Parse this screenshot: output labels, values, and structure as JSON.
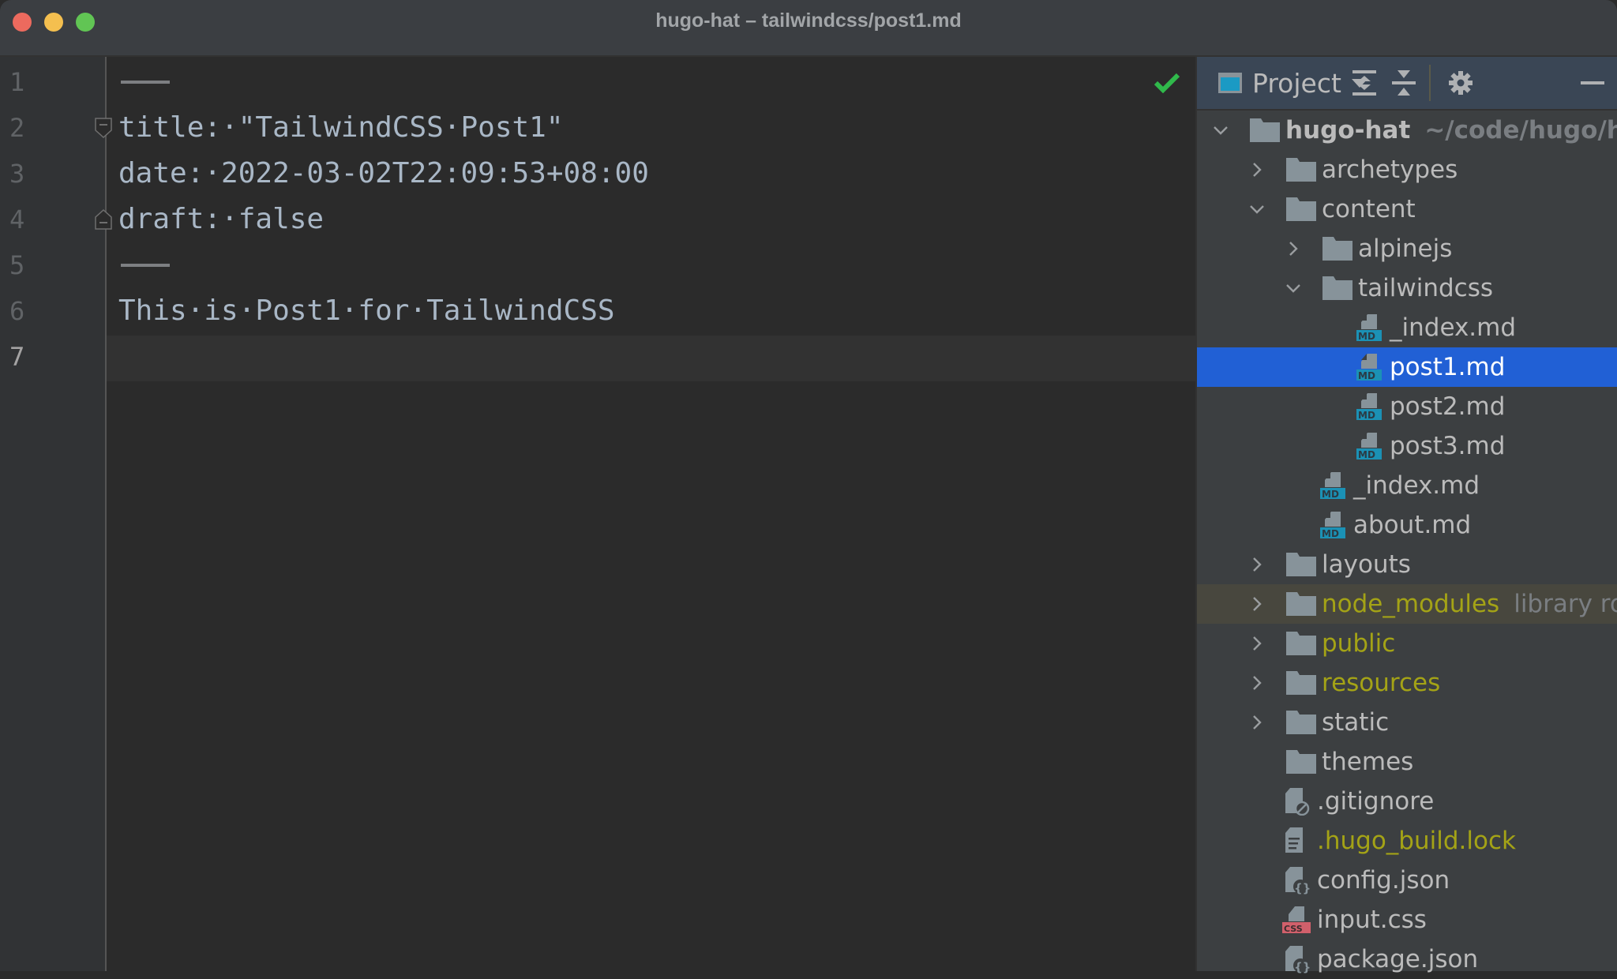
{
  "window": {
    "title": "hugo-hat – tailwindcss/post1.md"
  },
  "editor": {
    "lines": [
      {
        "num": "1",
        "text": "",
        "type": "front-matter-delimiter"
      },
      {
        "num": "2",
        "text": "title:·\"TailwindCSS·Post1\"",
        "type": "code",
        "fold": "start"
      },
      {
        "num": "3",
        "text": "date:·2022-03-02T22:09:53+08:00",
        "type": "code"
      },
      {
        "num": "4",
        "text": "draft:·false",
        "type": "code",
        "fold": "end"
      },
      {
        "num": "5",
        "text": "",
        "type": "front-matter-delimiter"
      },
      {
        "num": "6",
        "text": "This·is·Post1·for·TailwindCSS",
        "type": "code"
      },
      {
        "num": "7",
        "text": "",
        "type": "current"
      }
    ],
    "inspection_status": "no-problems",
    "colors": {
      "text": "#a9b7c6",
      "check": "#30b94b"
    }
  },
  "project_panel": {
    "title": "Project",
    "toolbar": [
      "expand-all-icon",
      "collapse-all-icon",
      "gear-icon",
      "minimize-icon"
    ],
    "tree": [
      {
        "label": "hugo-hat",
        "hint": "~/code/hugo/hu",
        "level": 0,
        "kind": "folder",
        "expanded": true,
        "bold": true
      },
      {
        "label": "archetypes",
        "level": 1,
        "kind": "folder",
        "expanded": false
      },
      {
        "label": "content",
        "level": 1,
        "kind": "folder",
        "expanded": true
      },
      {
        "label": "alpinejs",
        "level": 2,
        "kind": "folder",
        "expanded": false
      },
      {
        "label": "tailwindcss",
        "level": 2,
        "kind": "folder",
        "expanded": true
      },
      {
        "label": "_index.md",
        "level": 3,
        "kind": "md"
      },
      {
        "label": "post1.md",
        "level": 3,
        "kind": "md",
        "selected": true
      },
      {
        "label": "post2.md",
        "level": 3,
        "kind": "md"
      },
      {
        "label": "post3.md",
        "level": 3,
        "kind": "md"
      },
      {
        "label": "_index.md",
        "level": 2,
        "kind": "md"
      },
      {
        "label": "about.md",
        "level": 2,
        "kind": "md"
      },
      {
        "label": "layouts",
        "level": 1,
        "kind": "folder",
        "expanded": false
      },
      {
        "label": "node_modules",
        "hint": "library ro",
        "level": 1,
        "kind": "folder",
        "expanded": false,
        "excluded": true,
        "library": true
      },
      {
        "label": "public",
        "level": 1,
        "kind": "folder",
        "expanded": false,
        "excluded": true
      },
      {
        "label": "resources",
        "level": 1,
        "kind": "folder",
        "expanded": false,
        "excluded": true
      },
      {
        "label": "static",
        "level": 1,
        "kind": "folder",
        "expanded": false
      },
      {
        "label": "themes",
        "level": 1,
        "kind": "folder",
        "leaf": true
      },
      {
        "label": ".gitignore",
        "level": 1,
        "kind": "gitignore"
      },
      {
        "label": ".hugo_build.lock",
        "level": 1,
        "kind": "text",
        "excluded": true
      },
      {
        "label": "config.json",
        "level": 1,
        "kind": "json"
      },
      {
        "label": "input.css",
        "level": 1,
        "kind": "css"
      },
      {
        "label": "package.json",
        "level": 1,
        "kind": "json"
      }
    ],
    "colors": {
      "selected": "#2160d5",
      "excluded": "#a4a316",
      "library_bg": "#48473e",
      "md_badge": "#1e90b4",
      "css_badge": "#d1606b"
    }
  }
}
